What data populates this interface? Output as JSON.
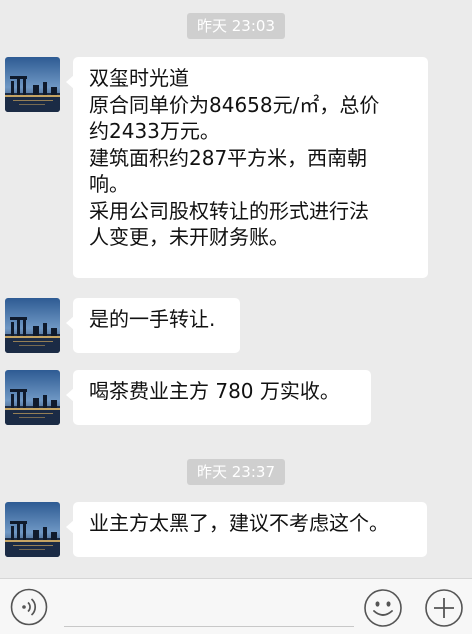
{
  "messages": [
    {
      "type": "time",
      "text": "昨天 23:03"
    },
    {
      "type": "msg",
      "text": "双玺时光道\n原合同单价为84658元/㎡，总价\n约2433万元。\n建筑面积约287平方米，西南朝\n响。\n采用公司股权转让的形式进行法\n人变更，未开财务账。"
    },
    {
      "type": "msg",
      "text": "是的一手转让."
    },
    {
      "type": "msg",
      "text": "喝茶费业主方 780 万实收。"
    },
    {
      "type": "time",
      "text": "昨天 23:37"
    },
    {
      "type": "msg",
      "text": "业主方太黑了，建议不考虑这个。"
    }
  ],
  "toolbar": {
    "voice_icon": "voice-icon",
    "emoji_icon": "emoji-icon",
    "plus_icon": "plus-icon"
  },
  "colors": {
    "background": "#ebebeb",
    "bubble": "#ffffff",
    "timestamp_bg": "#cfcfcf"
  }
}
